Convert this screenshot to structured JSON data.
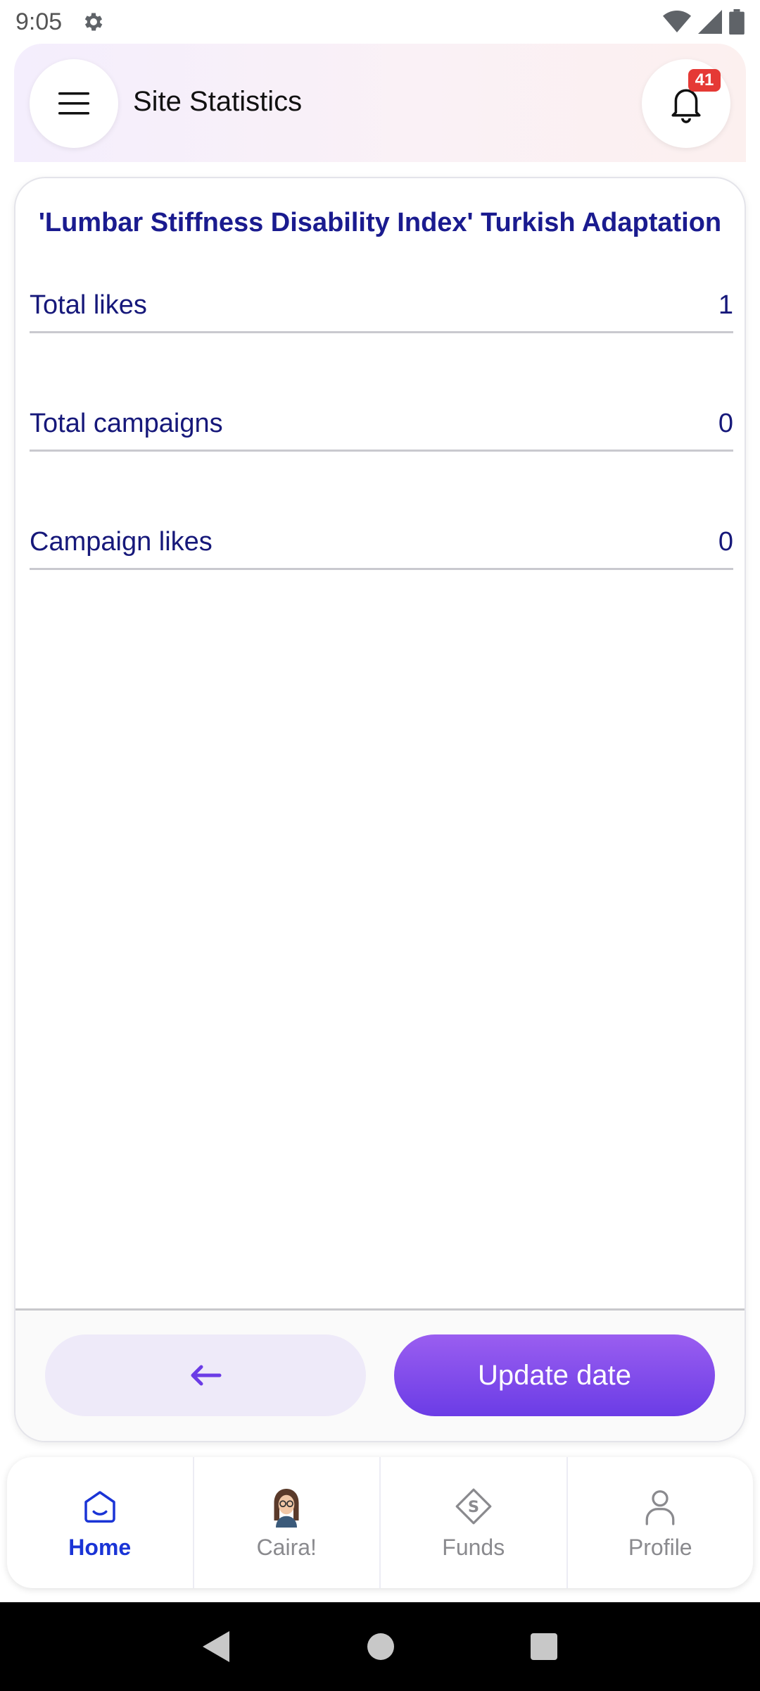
{
  "status_bar": {
    "time": "9:05"
  },
  "header": {
    "title": "Site Statistics",
    "notification_count": "41"
  },
  "card": {
    "title": "'Lumbar Stiffness Disability Index' Turkish Adaptation",
    "stats": [
      {
        "label": "Total likes",
        "value": "1"
      },
      {
        "label": "Total campaigns",
        "value": "0"
      },
      {
        "label": "Campaign likes",
        "value": "0"
      }
    ],
    "update_button": "Update date"
  },
  "bottom_nav": {
    "items": [
      {
        "label": "Home",
        "icon": "home-icon",
        "active": true
      },
      {
        "label": "Caira!",
        "icon": "caira-avatar-icon",
        "active": false
      },
      {
        "label": "Funds",
        "icon": "funds-icon",
        "active": false
      },
      {
        "label": "Profile",
        "icon": "profile-icon",
        "active": false
      }
    ]
  },
  "colors": {
    "accent": "#6b3ce6",
    "title_blue": "#1a1b8f",
    "nav_active": "#1a34d6",
    "badge": "#e53935"
  }
}
